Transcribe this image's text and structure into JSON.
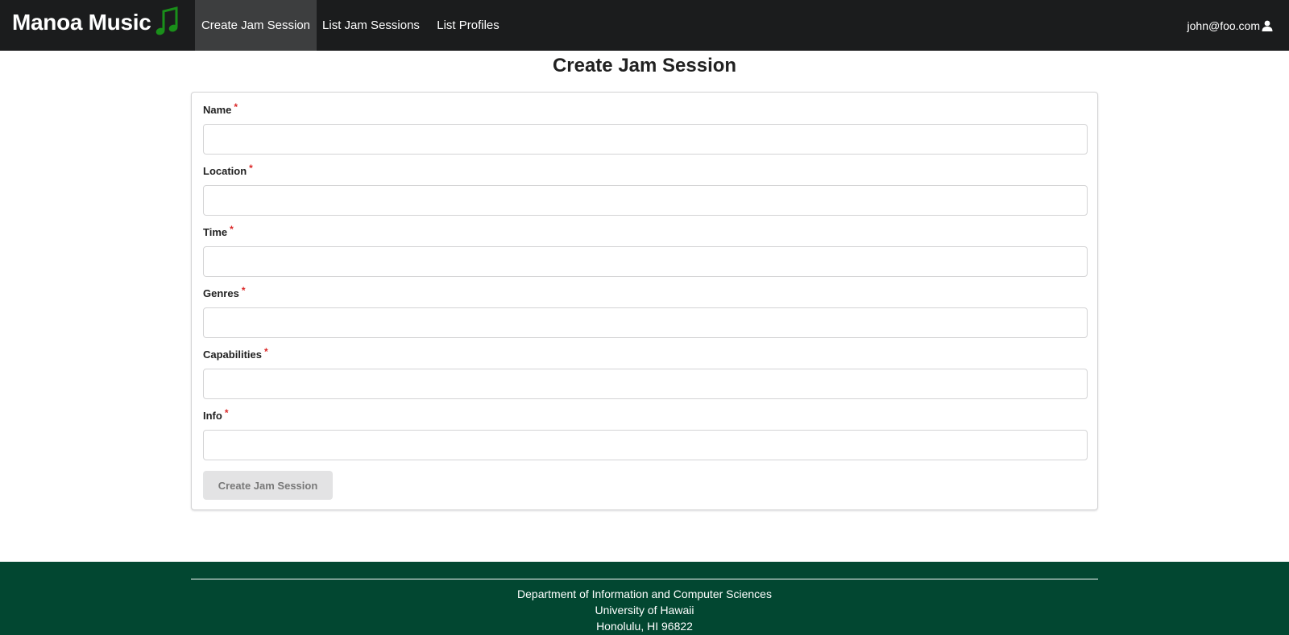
{
  "navbar": {
    "brand": "Manoa Music",
    "brand_icon": "music-note-icon",
    "brand_icon_color": "#1a8f1a",
    "items": [
      {
        "label": "Create Jam Session",
        "active": true
      },
      {
        "label": "List Jam Sessions",
        "active": false
      },
      {
        "label": "List Profiles",
        "active": false
      }
    ],
    "user": "john@foo.com",
    "user_icon": "user-icon"
  },
  "page": {
    "title": "Create Jam Session"
  },
  "form": {
    "required_marker": "*",
    "fields": [
      {
        "label": "Name",
        "value": ""
      },
      {
        "label": "Location",
        "value": ""
      },
      {
        "label": "Time",
        "value": ""
      },
      {
        "label": "Genres",
        "value": ""
      },
      {
        "label": "Capabilities",
        "value": ""
      },
      {
        "label": "Info",
        "value": ""
      }
    ],
    "submit_label": "Create Jam Session"
  },
  "footer": {
    "lines": [
      "Department of Information and Computer Sciences",
      "University of Hawaii",
      "Honolulu, HI 96822"
    ]
  },
  "colors": {
    "navbar_bg": "#1b1c1d",
    "footer_bg": "#024731",
    "required": "#db2828"
  }
}
